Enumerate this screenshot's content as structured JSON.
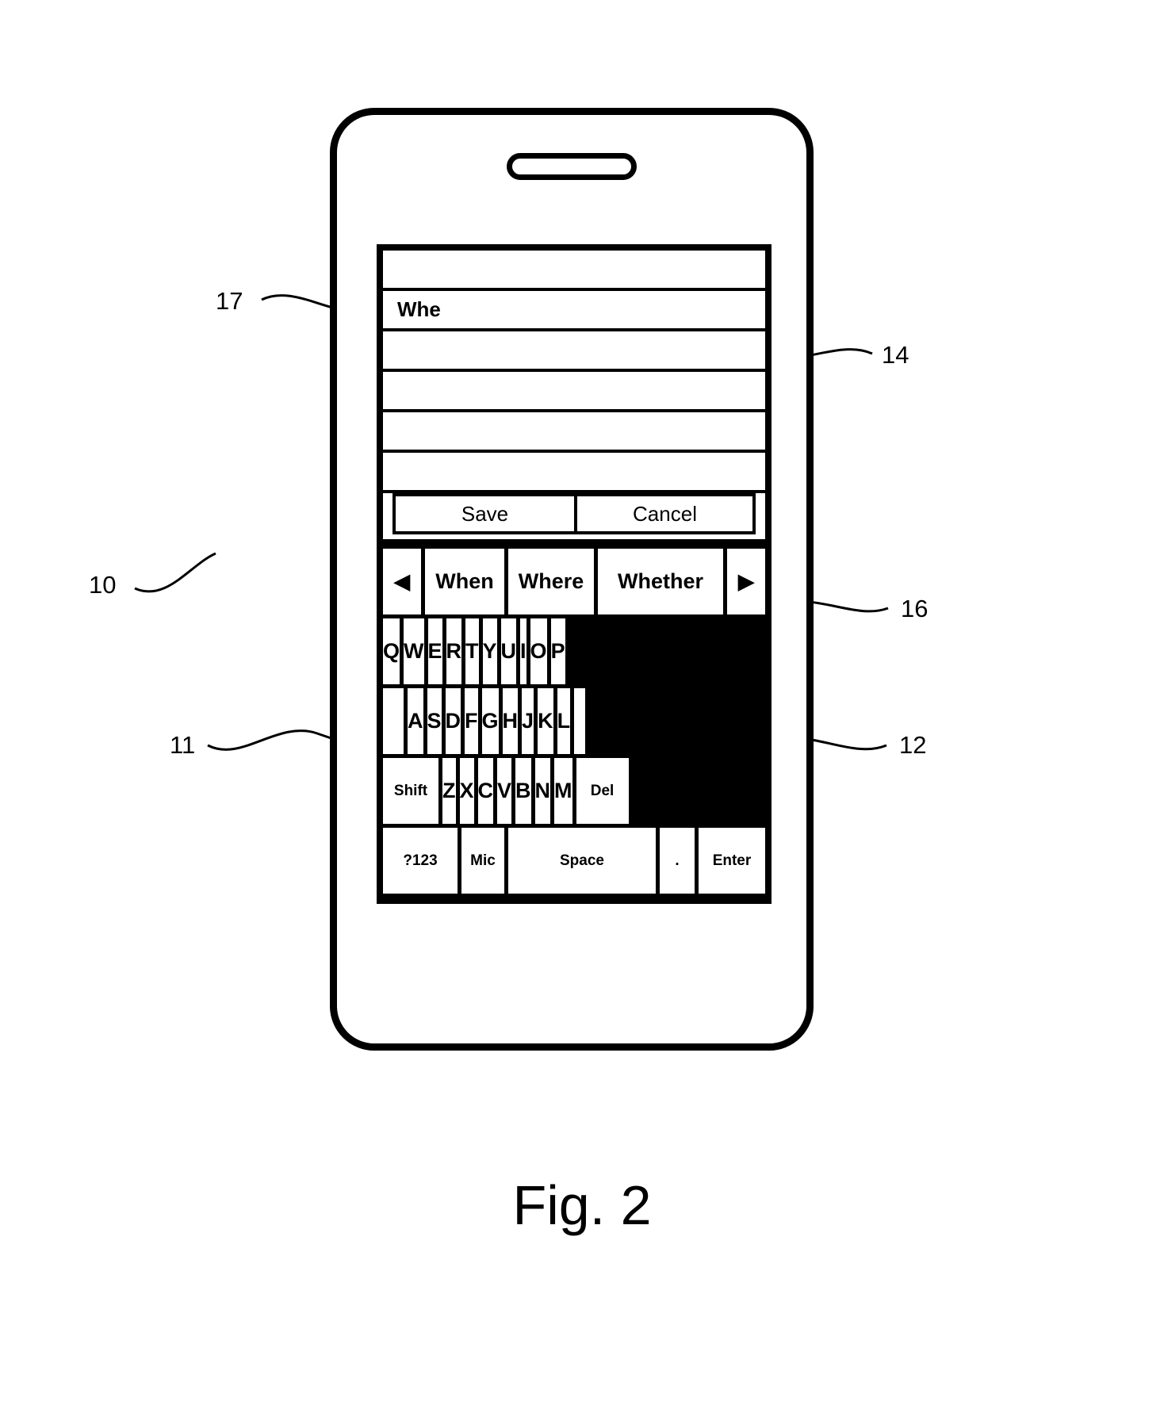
{
  "figure": {
    "caption": "Fig. 2",
    "reference_numerals": [
      {
        "id": "10",
        "label": "10",
        "target": "mobile-device"
      },
      {
        "id": "11",
        "label": "11",
        "target": "display"
      },
      {
        "id": "12",
        "label": "12",
        "target": "keyboard"
      },
      {
        "id": "14",
        "label": "14",
        "target": "text-entry-area"
      },
      {
        "id": "16",
        "label": "16",
        "target": "word-suggestion-bar"
      },
      {
        "id": "17",
        "label": "17",
        "target": "entered-text"
      }
    ]
  },
  "device": {
    "speaker_label": "speaker-grille"
  },
  "text_area": {
    "lines": [
      "",
      "Whe",
      "",
      "",
      "",
      ""
    ],
    "entered_text": "Whe"
  },
  "actions": {
    "save_label": "Save",
    "cancel_label": "Cancel"
  },
  "suggestion_bar": {
    "prev_icon": "◀",
    "next_icon": "▶",
    "suggestions": [
      "When",
      "Where",
      "Whether"
    ]
  },
  "keyboard": {
    "rows": [
      {
        "name": "row-qwerty",
        "keys": [
          {
            "label": "Q",
            "type": "letter"
          },
          {
            "label": "W",
            "type": "letter"
          },
          {
            "label": "E",
            "type": "letter"
          },
          {
            "label": "R",
            "type": "letter"
          },
          {
            "label": "T",
            "type": "letter"
          },
          {
            "label": "Y",
            "type": "letter"
          },
          {
            "label": "U",
            "type": "letter"
          },
          {
            "label": "I",
            "type": "letter"
          },
          {
            "label": "O",
            "type": "letter"
          },
          {
            "label": "P",
            "type": "letter"
          }
        ]
      },
      {
        "name": "row-asdf",
        "keys": [
          {
            "label": "A",
            "type": "letter"
          },
          {
            "label": "S",
            "type": "letter"
          },
          {
            "label": "D",
            "type": "letter"
          },
          {
            "label": "F",
            "type": "letter"
          },
          {
            "label": "G",
            "type": "letter"
          },
          {
            "label": "H",
            "type": "letter"
          },
          {
            "label": "J",
            "type": "letter"
          },
          {
            "label": "K",
            "type": "letter"
          },
          {
            "label": "L",
            "type": "letter"
          }
        ]
      },
      {
        "name": "row-zxcv",
        "keys": [
          {
            "label": "Shift",
            "type": "modifier"
          },
          {
            "label": "Z",
            "type": "letter"
          },
          {
            "label": "X",
            "type": "letter"
          },
          {
            "label": "C",
            "type": "letter"
          },
          {
            "label": "V",
            "type": "letter"
          },
          {
            "label": "B",
            "type": "letter"
          },
          {
            "label": "N",
            "type": "letter"
          },
          {
            "label": "M",
            "type": "letter"
          },
          {
            "label": "Del",
            "type": "modifier"
          }
        ]
      },
      {
        "name": "row-bottom",
        "keys": [
          {
            "label": "?123",
            "type": "modifier"
          },
          {
            "label": "Mic",
            "type": "modifier"
          },
          {
            "label": "Space",
            "type": "space"
          },
          {
            "label": ".",
            "type": "punctuation"
          },
          {
            "label": "Enter",
            "type": "modifier"
          }
        ]
      }
    ]
  }
}
